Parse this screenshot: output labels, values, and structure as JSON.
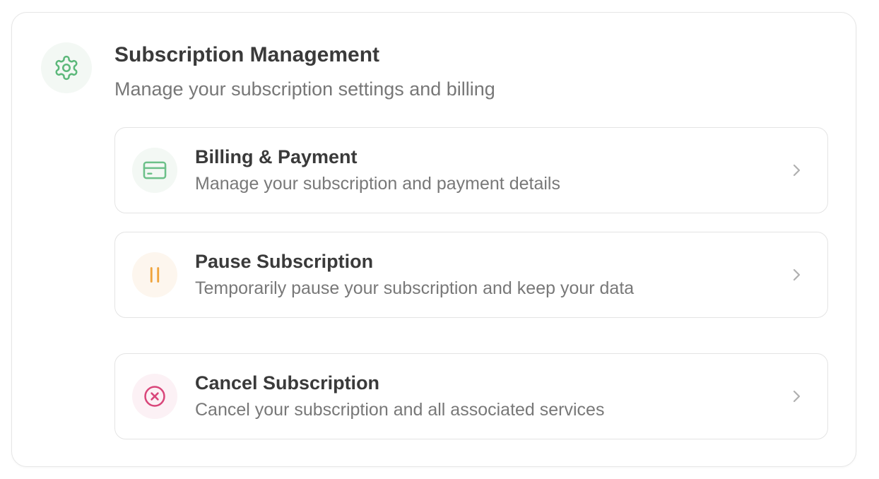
{
  "header": {
    "title": "Subscription Management",
    "subtitle": "Manage your subscription settings and billing",
    "icon": "gear-icon",
    "icon_color": "#5cb87a",
    "icon_bg": "#f3f8f4"
  },
  "options": [
    {
      "title": "Billing & Payment",
      "description": "Manage your subscription and payment details",
      "icon": "credit-card-icon",
      "icon_color": "#6cc089",
      "icon_bg": "#f3f8f4"
    },
    {
      "title": "Pause Subscription",
      "description": "Temporarily pause your subscription and keep your data",
      "icon": "pause-icon",
      "icon_color": "#f0a43c",
      "icon_bg": "#fdf6ee"
    },
    {
      "title": "Cancel Subscription",
      "description": "Cancel your subscription and all associated services",
      "icon": "cancel-circle-icon",
      "icon_color": "#d9467a",
      "icon_bg": "#fcf1f5"
    }
  ],
  "colors": {
    "chevron": "#b0b0b0",
    "border": "#e4e4e4",
    "title_text": "#3a3a3a",
    "secondary_text": "#777777"
  }
}
